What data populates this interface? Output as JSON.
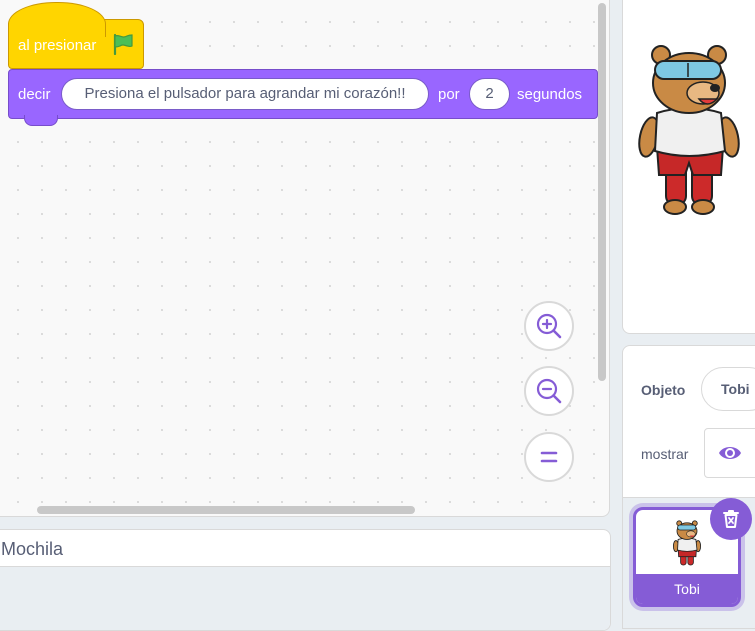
{
  "colors": {
    "events_block": "#ffd500",
    "looks_block": "#9966ff",
    "accent": "#855cd6",
    "text": "#575e75"
  },
  "code": {
    "hat_block": {
      "label": "al presionar",
      "icon": "green-flag-icon"
    },
    "say_block": {
      "label_say": "decir",
      "message": "Presiona el pulsador para agrandar mi corazón!!",
      "label_for": "por",
      "seconds": "2",
      "label_seconds": "segundos"
    },
    "zoom_controls": [
      {
        "name": "zoom-in-icon"
      },
      {
        "name": "zoom-out-icon"
      },
      {
        "name": "zoom-reset-icon"
      }
    ]
  },
  "backpack": {
    "title": "Mochila"
  },
  "sprite_info": {
    "sprite_label": "Objeto",
    "sprite_name": "Tobi",
    "show_label": "mostrar",
    "visibility_icon": "eye-icon"
  },
  "sprite_list": {
    "items": [
      {
        "name": "Tobi",
        "selected": true
      }
    ],
    "delete_icon": "trash-icon"
  }
}
